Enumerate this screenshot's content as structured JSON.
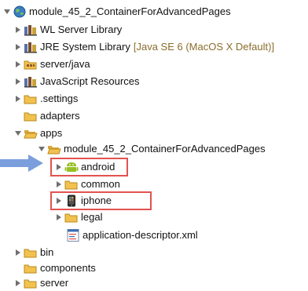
{
  "tree": {
    "project": "module_45_2_ContainerForAdvancedPages",
    "wl_server_library": "WL Server Library",
    "jre_library": "JRE System Library",
    "jre_decoration": "[Java SE 6 (MacOS X Default)]",
    "server_java": "server/java",
    "javascript_resources": "JavaScript Resources",
    "settings": ".settings",
    "adapters": "adapters",
    "apps": "apps",
    "app_folder": "module_45_2_ContainerForAdvancedPages",
    "android": "android",
    "common": "common",
    "iphone": "iphone",
    "legal": "legal",
    "app_descriptor": "application-descriptor.xml",
    "bin": "bin",
    "components": "components",
    "server": "server"
  },
  "colors": {
    "highlight_border": "#e2534f",
    "pointer_arrow": "#7b9fdc",
    "folder": "#f2c14e",
    "android_green": "#97c024"
  },
  "icons": {
    "project": "project-globe-icon",
    "library": "library-books-icon",
    "package_folder": "package-folder-icon",
    "folder": "folder-icon",
    "android": "android-icon",
    "iphone": "iphone-icon",
    "xml": "xml-file-icon",
    "pointer": "pointer-arrow-icon"
  }
}
